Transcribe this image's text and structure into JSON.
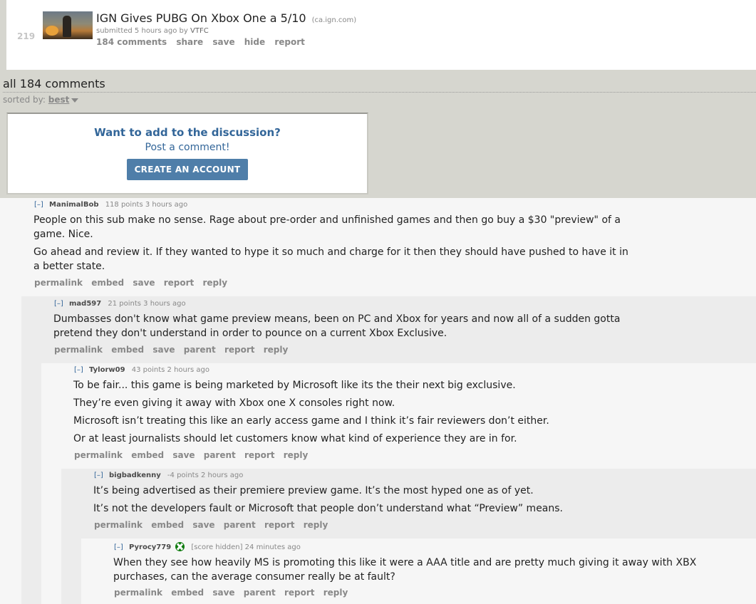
{
  "post": {
    "score": "219",
    "title": "IGN Gives PUBG On Xbox One a 5/10",
    "domain": "(ca.ign.com)",
    "submitted": "submitted 5 hours ago by",
    "author": "VTFC",
    "buttons": {
      "comments": "184 comments",
      "share": "share",
      "save": "save",
      "hide": "hide",
      "report": "report"
    }
  },
  "comments_header": {
    "title": "all 184 comments",
    "sorted_label": "sorted by:",
    "sorted_value": "best"
  },
  "signup": {
    "question": "Want to add to the discussion?",
    "prompt": "Post a comment!",
    "button": "CREATE AN ACCOUNT"
  },
  "comments": [
    {
      "expander": "[–]",
      "author": "ManimalBob",
      "score": "118 points 3 hours ago",
      "paragraphs": [
        "People on this sub make no sense. Rage about pre-order and unfinished games and then go buy a $30 \"preview\" of a game. Nice.",
        "Go ahead and review it. If they wanted to hype it so much and charge for it then they should have pushed to have it in a better state."
      ],
      "actions": [
        "permalink",
        "embed",
        "save",
        "report",
        "reply"
      ]
    },
    {
      "expander": "[–]",
      "author": "mad597",
      "score": "21 points 3 hours ago",
      "paragraphs": [
        "Dumbasses don't know what game preview means, been on PC and Xbox for years and now all of a sudden gotta pretend they don't understand in order to pounce on a current Xbox Exclusive."
      ],
      "actions": [
        "permalink",
        "embed",
        "save",
        "parent",
        "report",
        "reply"
      ]
    },
    {
      "expander": "[–]",
      "author": "Tylorw09",
      "score": "43 points 2 hours ago",
      "paragraphs": [
        "To be fair... this game is being marketed by Microsoft like its the their next big exclusive.",
        "They’re even giving it away with Xbox one X consoles right now.",
        "Microsoft isn’t treating this like an early access game and I think it’s fair reviewers don’t either.",
        "Or at least journalists should let customers know what kind of experience they are in for."
      ],
      "actions": [
        "permalink",
        "embed",
        "save",
        "parent",
        "report",
        "reply"
      ]
    },
    {
      "expander": "[–]",
      "author": "bigbadkenny",
      "score": "-4 points 2 hours ago",
      "paragraphs": [
        "It’s being advertised as their premiere preview game. It’s the most hyped one as of yet.",
        "It’s not the developers fault or Microsoft that people don’t understand what “Preview” means."
      ],
      "actions": [
        "permalink",
        "embed",
        "save",
        "parent",
        "report",
        "reply"
      ]
    },
    {
      "expander": "[–]",
      "author": "Pyrocy779",
      "score": "[score hidden] 24 minutes ago",
      "flair_icon": "xbox-logo-icon",
      "paragraphs": [
        "When they see how heavily MS is promoting this like it were a AAA title and are pretty much giving it away with XBX purchases, can the average consumer really be at fault?"
      ],
      "actions": [
        "permalink",
        "embed",
        "save",
        "parent",
        "report",
        "reply"
      ]
    }
  ],
  "colors": {
    "page_bg": "#d6d6cf",
    "link_blue": "#336699",
    "button_blue": "#4f7ea9",
    "xbox_green": "#107c10"
  }
}
